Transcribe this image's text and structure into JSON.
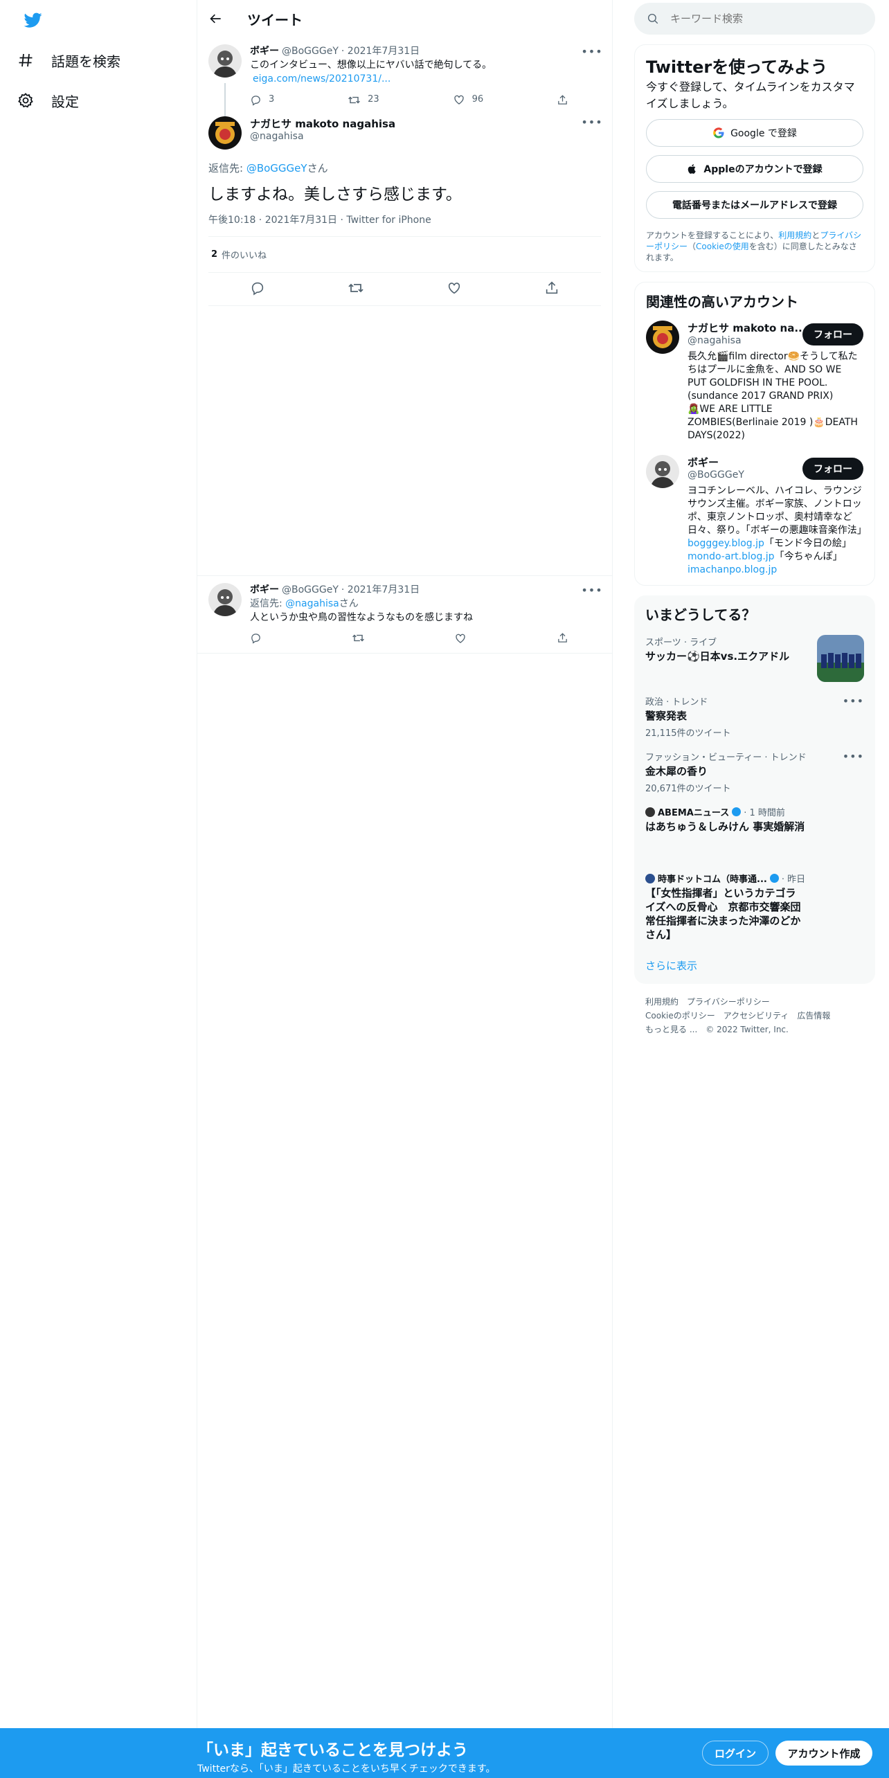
{
  "nav": {
    "explore_label": "話題を検索",
    "settings_label": "設定"
  },
  "header": {
    "title": "ツイート"
  },
  "parent_tweet": {
    "name": "ボギー",
    "handle": "@BoGGGeY",
    "date": "· 2021年7月31日",
    "text": "このインタビュー、想像以上にヤバい話で絶句してる。",
    "link": "eiga.com/news/20210731/...",
    "replies": "3",
    "retweets": "23",
    "likes": "96"
  },
  "focus_tweet": {
    "name": "ナガヒサ makoto nagahisa",
    "handle": "@nagahisa",
    "reply_prefix": "返信先: ",
    "reply_to": "@BoGGGeY",
    "reply_suffix": "さん",
    "text": "しますよね。美しさすら感じます。",
    "time": "午後10:18 · 2021年7月31日 · Twitter for iPhone",
    "like_count": "2",
    "like_label": "件のいいね"
  },
  "reply_tweet": {
    "name": "ボギー",
    "handle": "@BoGGGeY",
    "date": "· 2021年7月31日",
    "reply_prefix": "返信先: ",
    "reply_to": "@nagahisa",
    "reply_suffix": "さん",
    "text": "人というか虫や鳥の習性なようなものを感じますね"
  },
  "search": {
    "placeholder": "キーワード検索"
  },
  "signup": {
    "title": "Twitterを使ってみよう",
    "subtitle": "今すぐ登録して、タイムラインをカスタマイズしましょう。",
    "google_label": "Google で登録",
    "apple_label": "Appleのアカウントで登録",
    "phone_label": "電話番号またはメールアドレスで登録",
    "terms_pre": "アカウントを登録することにより、",
    "terms_link1": "利用規約",
    "terms_mid1": "と",
    "terms_link2": "プライバシーポリシー",
    "terms_mid2": "（",
    "terms_link3": "Cookieの使用",
    "terms_post": "を含む）に同意したとみなされます。"
  },
  "related": {
    "title": "関連性の高いアカウント",
    "accounts": [
      {
        "name": "ナガヒサ makoto na...",
        "handle": "@nagahisa",
        "follow": "フォロー",
        "bio": "長久允🎬film director🥯そうして私たちはプールに金魚を、AND SO WE PUT GOLDFISH IN THE POOL.(sundance 2017 GRAND PRIX) 🧟‍♀️WE ARE LITTLE ZOMBIES(Berlinaie 2019 )🎂DEATH DAYS(2022)"
      },
      {
        "name": "ボギー",
        "handle": "@BoGGGeY",
        "follow": "フォロー",
        "bio_pre": "ヨコチンレーベル、ハイコレ、ラウンジサウンズ主催。ボギー家族、ノントロッポ、東京ノントロッポ、奥村靖幸など日々、祭り。「ボギーの悪趣味音楽作法」",
        "link1": "bogggey.blog.jp",
        "bio_mid1": "「モンド今日の絵」",
        "link2": "mondo-art.blog.jp",
        "bio_mid2": "「今ちゃんぽ」",
        "link3": "imachanpo.blog.jp"
      }
    ]
  },
  "trends": {
    "title": "いまどうしてる？",
    "items": [
      {
        "category": "スポーツ · ライブ",
        "title": "サッカー⚽日本vs.エクアドル"
      },
      {
        "category": "政治 · トレンド",
        "title": "警察発表",
        "count": "21,115件のツイート"
      },
      {
        "category": "ファッション・ビューティー · トレンド",
        "title": "金木犀の香り",
        "count": "20,671件のツイート"
      },
      {
        "source": "ABEMAニュース",
        "time": "· 1 時間前",
        "title": "はあちゅう＆しみけん 事実婚解消"
      },
      {
        "source": "時事ドットコム（時事通...",
        "time": "· 昨日",
        "title": "【「女性指揮者」というカテゴライズへの反骨心　京都市交響楽団常任指揮者に決まった沖澤のどかさん】"
      }
    ],
    "show_more": "さらに表示"
  },
  "footer": {
    "terms": "利用規約",
    "privacy": "プライバシーポリシー",
    "cookie": "Cookieのポリシー",
    "accessibility": "アクセシビリティ",
    "ads": "広告情報",
    "more": "もっと見る ...",
    "copyright": "© 2022 Twitter, Inc."
  },
  "bottombar": {
    "headline": "「いま」起きていることを見つけよう",
    "subline": "Twitterなら、「いま」起きていることをいち早くチェックできます。",
    "login": "ログイン",
    "signup": "アカウント作成"
  },
  "colors": {
    "accent": "#1d9bf0",
    "text": "#0f1419",
    "muted": "#536471"
  }
}
